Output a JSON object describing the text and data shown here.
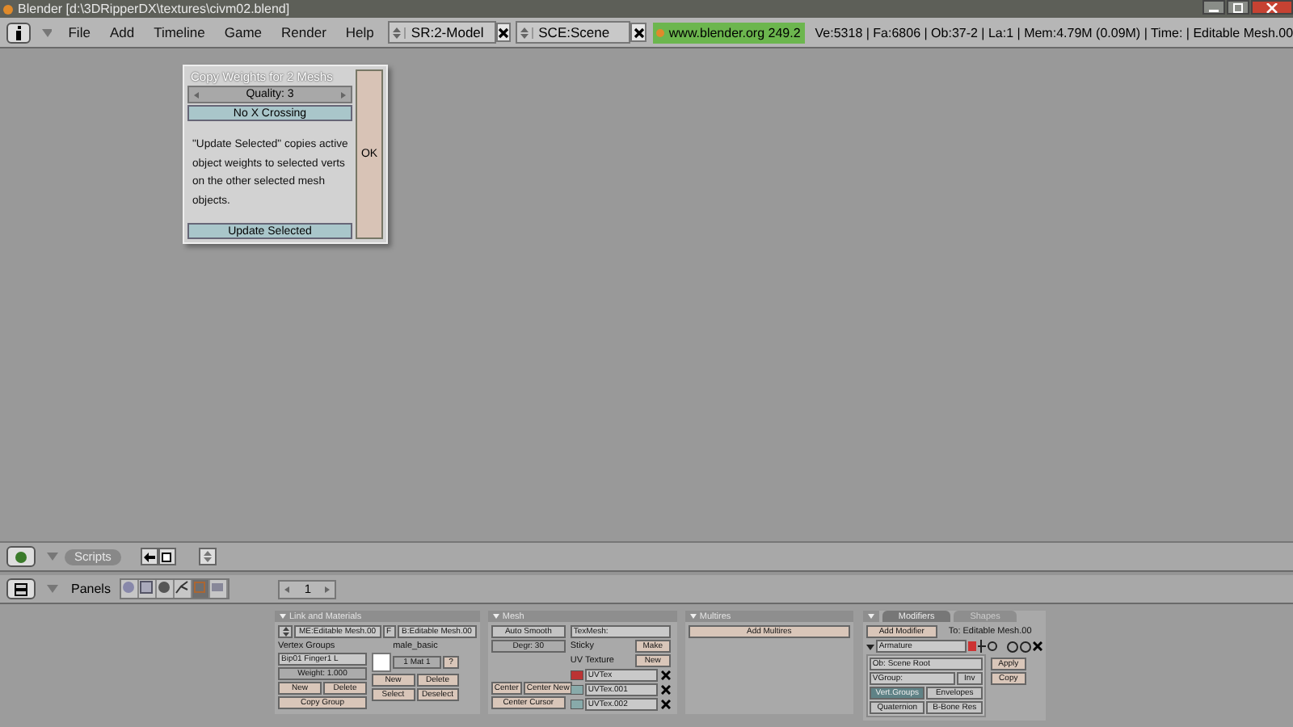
{
  "window": {
    "title": "Blender [d:\\3DRipperDX\\textures\\civm02.blend]"
  },
  "header": {
    "menus": [
      "File",
      "Add",
      "Timeline",
      "Game",
      "Render",
      "Help"
    ],
    "screen": "SR:2-Model",
    "scene": "SCE:Scene",
    "version": "www.blender.org 249.2",
    "stats": "Ve:5318 | Fa:6806 | Ob:37-2 | La:1  | Mem:4.79M (0.09M)  | Time: | Editable Mesh.00"
  },
  "dialog": {
    "title": "Copy Weights for 2 Meshs",
    "quality": "Quality: 3",
    "toggle": "No X Crossing",
    "description": "\"Update Selected\" copies active object weights to selected verts on the other selected mesh objects.",
    "update_button": "Update Selected",
    "ok_button": "OK"
  },
  "scripts_header": {
    "label": "Scripts"
  },
  "buttons_header": {
    "label": "Panels",
    "frame": "1"
  },
  "link_materials": {
    "title": "Link and Materials",
    "mesh_name": "ME:Editable Mesh.00",
    "f_label": "F",
    "object_name": "B:Editable Mesh.00",
    "vertex_groups_label": "Vertex Groups",
    "vertex_group": "Bip01 Finger1 L",
    "weight": "Weight: 1.000",
    "group_buttons": [
      "New",
      "Delete"
    ],
    "copy_group": "Copy Group",
    "material_name": "male_basic",
    "material_index": "1 Mat 1",
    "material_help": "?",
    "material_buttons": [
      "New",
      "Delete",
      "Select",
      "Deselect"
    ]
  },
  "mesh": {
    "title": "Mesh",
    "auto_smooth": "Auto Smooth",
    "degr": "Degr: 30",
    "center_buttons": [
      "Center",
      "Center New"
    ],
    "center_cursor": "Center Cursor",
    "texmesh": "TexMesh:",
    "sticky": "Sticky",
    "make": "Make",
    "uv_label": "UV Texture",
    "uv_new": "New",
    "uv_layers": [
      {
        "name": "UVTex",
        "selected": true
      },
      {
        "name": "UVTex.001",
        "selected": false
      },
      {
        "name": "UVTex.002",
        "selected": false
      }
    ]
  },
  "multires": {
    "title": "Multires",
    "add": "Add Multires"
  },
  "modifiers": {
    "tabs": [
      {
        "label": "Modifiers",
        "selected": true
      },
      {
        "label": "Shapes",
        "selected": false
      }
    ],
    "add": "Add Modifier",
    "target": "To: Editable Mesh.00",
    "modifier": {
      "name": "Armature",
      "expanded": true,
      "object": "Ob: Scene Root",
      "vgroup": "VGroup:",
      "inv": "Inv",
      "toggles": [
        {
          "label": "Vert.Groups",
          "on": true
        },
        {
          "label": "Envelopes",
          "on": false
        },
        {
          "label": "Quaternion",
          "on": false
        },
        {
          "label": "B-Bone Res",
          "on": false
        }
      ],
      "apply": "Apply",
      "copy": "Copy"
    }
  }
}
